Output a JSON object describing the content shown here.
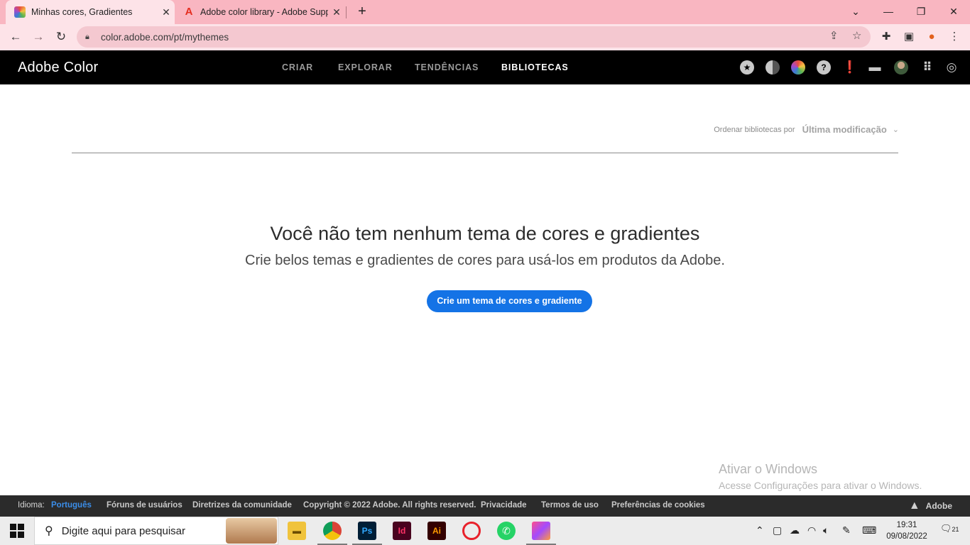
{
  "browser": {
    "tabs": [
      {
        "title": "Minhas cores, Gradientes",
        "active": true
      },
      {
        "title": "Adobe color library - Adobe Supp",
        "active": false
      }
    ],
    "address": "color.adobe.com/pt/mythemes"
  },
  "app": {
    "brand": "Adobe Color",
    "nav": [
      {
        "label": "CRIAR"
      },
      {
        "label": "EXPLORAR"
      },
      {
        "label": "TENDÊNCIAS"
      },
      {
        "label": "BIBLIOTECAS",
        "active": true
      }
    ]
  },
  "sort": {
    "label": "Ordenar bibliotecas por",
    "value": "Última modificação"
  },
  "empty_state": {
    "title": "Você não tem nenhum tema de cores e gradientes",
    "subtitle": "Crie belos temas e gradientes de cores para usá-los em produtos da Adobe.",
    "cta": "Crie um tema de cores e gradiente"
  },
  "watermark": {
    "line1": "Ativar o Windows",
    "line2": "Acesse Configurações para ativar o Windows."
  },
  "footer": {
    "language_label": "Idioma:",
    "language_value": "Português",
    "links": [
      "Fóruns de usuários",
      "Diretrizes da comunidade",
      "Copyright © 2022 Adobe. All rights reserved.",
      "Privacidade",
      "Termos de uso",
      "Preferências de cookies"
    ],
    "adobe_label": "Adobe"
  },
  "taskbar": {
    "search_placeholder": "Digite aqui para pesquisar",
    "apps": [
      "Ps",
      "Id",
      "Ai"
    ],
    "time": "19:31",
    "date": "09/08/2022",
    "notifications": "21"
  }
}
